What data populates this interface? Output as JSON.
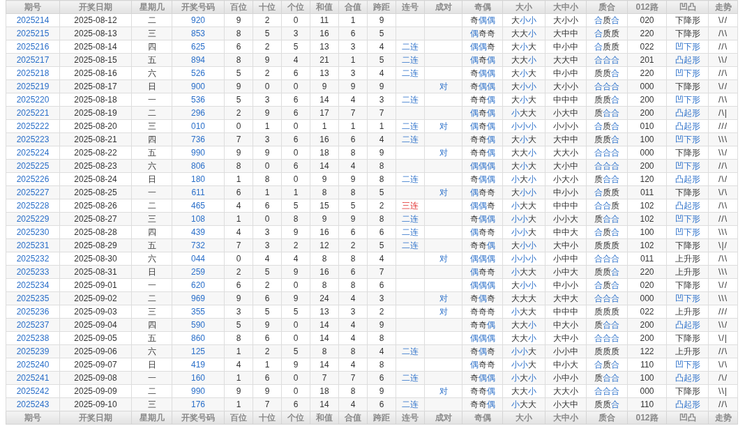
{
  "columns": [
    "期号",
    "开奖日期",
    "星期几",
    "开奖号码",
    "百位",
    "十位",
    "个位",
    "和值",
    "合值",
    "跨距",
    "连号",
    "成对",
    "奇偶",
    "大小",
    "大中小",
    "质合",
    "012路",
    "凹凸",
    "走势"
  ],
  "rows": [
    {
      "issue": "2025214",
      "date": "2025-08-12",
      "weekday": "二",
      "number": "920",
      "digits": [
        "9",
        "2",
        "0"
      ],
      "sum": "11",
      "sum_tail": "1",
      "span": "9",
      "parity": "奇偶偶",
      "parity_hl": [
        false,
        true,
        true
      ],
      "size": "大小小",
      "size_hl": [
        false,
        true,
        true
      ],
      "range": "大小小",
      "prime": "合质合",
      "prime_hl": [
        true,
        false,
        true
      ],
      "route": "020",
      "shape": "下降形",
      "shape_hl": false,
      "trend": "\\//"
    },
    {
      "issue": "2025215",
      "date": "2025-08-13",
      "weekday": "三",
      "number": "853",
      "digits": [
        "8",
        "5",
        "3"
      ],
      "sum": "16",
      "sum_tail": "6",
      "span": "5",
      "parity": "偶奇奇",
      "parity_hl": [
        true,
        false,
        false
      ],
      "size": "大大小",
      "size_hl": [
        false,
        false,
        true
      ],
      "range": "大中中",
      "prime": "合质质",
      "prime_hl": [
        true,
        false,
        false
      ],
      "route": "220",
      "shape": "下降形",
      "shape_hl": false,
      "trend": "/\\\\"
    },
    {
      "issue": "2025216",
      "date": "2025-08-14",
      "weekday": "四",
      "number": "625",
      "digits": [
        "6",
        "2",
        "5"
      ],
      "sum": "13",
      "sum_tail": "3",
      "span": "4",
      "consecutive": "二连",
      "consecutive_alert": false,
      "parity": "偶偶奇",
      "parity_hl": [
        true,
        true,
        false
      ],
      "size": "大小大",
      "size_hl": [
        false,
        true,
        false
      ],
      "range": "中小中",
      "prime": "合质质",
      "prime_hl": [
        true,
        false,
        false
      ],
      "route": "022",
      "shape": "凹下形",
      "shape_hl": true,
      "trend": "//\\"
    },
    {
      "issue": "2025217",
      "date": "2025-08-15",
      "weekday": "五",
      "number": "894",
      "digits": [
        "8",
        "9",
        "4"
      ],
      "sum": "21",
      "sum_tail": "1",
      "span": "5",
      "consecutive": "二连",
      "consecutive_alert": false,
      "parity": "偶奇偶",
      "parity_hl": [
        true,
        false,
        true
      ],
      "size": "大大小",
      "size_hl": [
        false,
        false,
        true
      ],
      "range": "大大中",
      "prime": "合合合",
      "prime_hl": [
        true,
        true,
        true
      ],
      "route": "201",
      "shape": "凸起形",
      "shape_hl": true,
      "trend": "\\\\/"
    },
    {
      "issue": "2025218",
      "date": "2025-08-16",
      "weekday": "六",
      "number": "526",
      "digits": [
        "5",
        "2",
        "6"
      ],
      "sum": "13",
      "sum_tail": "3",
      "span": "4",
      "consecutive": "二连",
      "consecutive_alert": false,
      "parity": "奇偶偶",
      "parity_hl": [
        false,
        true,
        true
      ],
      "size": "大小大",
      "size_hl": [
        false,
        true,
        false
      ],
      "range": "中小中",
      "prime": "质质合",
      "prime_hl": [
        false,
        false,
        true
      ],
      "route": "220",
      "shape": "凹下形",
      "shape_hl": true,
      "trend": "//\\"
    },
    {
      "issue": "2025219",
      "date": "2025-08-17",
      "weekday": "日",
      "number": "900",
      "digits": [
        "9",
        "0",
        "0"
      ],
      "sum": "9",
      "sum_tail": "9",
      "span": "9",
      "pair": "对",
      "parity": "奇偶偶",
      "parity_hl": [
        false,
        true,
        true
      ],
      "size": "大小小",
      "size_hl": [
        false,
        true,
        true
      ],
      "range": "大小小",
      "prime": "合合合",
      "prime_hl": [
        true,
        true,
        true
      ],
      "route": "000",
      "shape": "下降形",
      "shape_hl": false,
      "trend": "\\//"
    },
    {
      "issue": "2025220",
      "date": "2025-08-18",
      "weekday": "一",
      "number": "536",
      "digits": [
        "5",
        "3",
        "6"
      ],
      "sum": "14",
      "sum_tail": "4",
      "span": "3",
      "consecutive": "二连",
      "consecutive_alert": false,
      "parity": "奇奇偶",
      "parity_hl": [
        false,
        false,
        true
      ],
      "size": "大小大",
      "size_hl": [
        false,
        true,
        false
      ],
      "range": "中中中",
      "prime": "质质合",
      "prime_hl": [
        false,
        false,
        true
      ],
      "route": "200",
      "shape": "凹下形",
      "shape_hl": true,
      "trend": "/\\\\"
    },
    {
      "issue": "2025221",
      "date": "2025-08-19",
      "weekday": "二",
      "number": "296",
      "digits": [
        "2",
        "9",
        "6"
      ],
      "sum": "17",
      "sum_tail": "7",
      "span": "7",
      "parity": "偶奇偶",
      "parity_hl": [
        true,
        false,
        true
      ],
      "size": "小大大",
      "size_hl": [
        true,
        false,
        false
      ],
      "range": "小大中",
      "prime": "质合合",
      "prime_hl": [
        false,
        true,
        true
      ],
      "route": "200",
      "shape": "凸起形",
      "shape_hl": true,
      "trend": "/\\|"
    },
    {
      "issue": "2025222",
      "date": "2025-08-20",
      "weekday": "三",
      "number": "010",
      "digits": [
        "0",
        "1",
        "0"
      ],
      "sum": "1",
      "sum_tail": "1",
      "span": "1",
      "consecutive": "二连",
      "consecutive_alert": false,
      "pair": "对",
      "parity": "偶奇偶",
      "parity_hl": [
        true,
        false,
        true
      ],
      "size": "小小小",
      "size_hl": [
        true,
        true,
        true
      ],
      "range": "小小小",
      "prime": "合质合",
      "prime_hl": [
        true,
        false,
        true
      ],
      "route": "010",
      "shape": "凸起形",
      "shape_hl": true,
      "trend": "///"
    },
    {
      "issue": "2025223",
      "date": "2025-08-21",
      "weekday": "四",
      "number": "736",
      "digits": [
        "7",
        "3",
        "6"
      ],
      "sum": "16",
      "sum_tail": "6",
      "span": "4",
      "consecutive": "二连",
      "consecutive_alert": false,
      "parity": "奇奇偶",
      "parity_hl": [
        false,
        false,
        true
      ],
      "size": "大小大",
      "size_hl": [
        false,
        true,
        false
      ],
      "range": "大中中",
      "prime": "质质合",
      "prime_hl": [
        false,
        false,
        true
      ],
      "route": "100",
      "shape": "凹下形",
      "shape_hl": true,
      "trend": "\\\\\\"
    },
    {
      "issue": "2025224",
      "date": "2025-08-22",
      "weekday": "五",
      "number": "990",
      "digits": [
        "9",
        "9",
        "0"
      ],
      "sum": "18",
      "sum_tail": "8",
      "span": "9",
      "pair": "对",
      "parity": "奇奇偶",
      "parity_hl": [
        false,
        false,
        true
      ],
      "size": "大大小",
      "size_hl": [
        false,
        false,
        true
      ],
      "range": "大大小",
      "prime": "合合合",
      "prime_hl": [
        true,
        true,
        true
      ],
      "route": "000",
      "shape": "下降形",
      "shape_hl": false,
      "trend": "\\\\/"
    },
    {
      "issue": "2025225",
      "date": "2025-08-23",
      "weekday": "六",
      "number": "806",
      "digits": [
        "8",
        "0",
        "6"
      ],
      "sum": "14",
      "sum_tail": "4",
      "span": "8",
      "parity": "偶偶偶",
      "parity_hl": [
        true,
        true,
        true
      ],
      "size": "大小大",
      "size_hl": [
        false,
        true,
        false
      ],
      "range": "大小中",
      "prime": "合合合",
      "prime_hl": [
        true,
        true,
        true
      ],
      "route": "200",
      "shape": "凹下形",
      "shape_hl": true,
      "trend": "//\\"
    },
    {
      "issue": "2025226",
      "date": "2025-08-24",
      "weekday": "日",
      "number": "180",
      "digits": [
        "1",
        "8",
        "0"
      ],
      "sum": "9",
      "sum_tail": "9",
      "span": "8",
      "consecutive": "二连",
      "consecutive_alert": false,
      "parity": "奇偶偶",
      "parity_hl": [
        false,
        true,
        true
      ],
      "size": "小大小",
      "size_hl": [
        true,
        false,
        true
      ],
      "range": "小大小",
      "prime": "质合合",
      "prime_hl": [
        false,
        true,
        true
      ],
      "route": "120",
      "shape": "凸起形",
      "shape_hl": true,
      "trend": "/\\/"
    },
    {
      "issue": "2025227",
      "date": "2025-08-25",
      "weekday": "一",
      "number": "611",
      "digits": [
        "6",
        "1",
        "1"
      ],
      "sum": "8",
      "sum_tail": "8",
      "span": "5",
      "pair": "对",
      "parity": "偶奇奇",
      "parity_hl": [
        true,
        false,
        false
      ],
      "size": "大小小",
      "size_hl": [
        false,
        true,
        true
      ],
      "range": "中小小",
      "prime": "合质质",
      "prime_hl": [
        true,
        false,
        false
      ],
      "route": "011",
      "shape": "下降形",
      "shape_hl": false,
      "trend": "\\/\\"
    },
    {
      "issue": "2025228",
      "date": "2025-08-26",
      "weekday": "二",
      "number": "465",
      "digits": [
        "4",
        "6",
        "5"
      ],
      "sum": "15",
      "sum_tail": "5",
      "span": "2",
      "consecutive": "三连",
      "consecutive_alert": true,
      "parity": "偶偶奇",
      "parity_hl": [
        true,
        true,
        false
      ],
      "size": "小大大",
      "size_hl": [
        true,
        false,
        false
      ],
      "range": "中中中",
      "prime": "合合质",
      "prime_hl": [
        true,
        true,
        false
      ],
      "route": "102",
      "shape": "凸起形",
      "shape_hl": true,
      "trend": "/\\\\"
    },
    {
      "issue": "2025229",
      "date": "2025-08-27",
      "weekday": "三",
      "number": "108",
      "digits": [
        "1",
        "0",
        "8"
      ],
      "sum": "9",
      "sum_tail": "9",
      "span": "8",
      "consecutive": "二连",
      "consecutive_alert": false,
      "parity": "奇偶偶",
      "parity_hl": [
        false,
        true,
        true
      ],
      "size": "小小大",
      "size_hl": [
        true,
        true,
        false
      ],
      "range": "小小大",
      "prime": "质合合",
      "prime_hl": [
        false,
        true,
        true
      ],
      "route": "102",
      "shape": "凹下形",
      "shape_hl": true,
      "trend": "//\\"
    },
    {
      "issue": "2025230",
      "date": "2025-08-28",
      "weekday": "四",
      "number": "439",
      "digits": [
        "4",
        "3",
        "9"
      ],
      "sum": "16",
      "sum_tail": "6",
      "span": "6",
      "consecutive": "二连",
      "consecutive_alert": false,
      "parity": "偶奇奇",
      "parity_hl": [
        true,
        false,
        false
      ],
      "size": "小小大",
      "size_hl": [
        true,
        true,
        false
      ],
      "range": "中中大",
      "prime": "合质合",
      "prime_hl": [
        true,
        false,
        true
      ],
      "route": "100",
      "shape": "凹下形",
      "shape_hl": true,
      "trend": "\\\\\\"
    },
    {
      "issue": "2025231",
      "date": "2025-08-29",
      "weekday": "五",
      "number": "732",
      "digits": [
        "7",
        "3",
        "2"
      ],
      "sum": "12",
      "sum_tail": "2",
      "span": "5",
      "consecutive": "二连",
      "consecutive_alert": false,
      "parity": "奇奇偶",
      "parity_hl": [
        false,
        false,
        true
      ],
      "size": "大小小",
      "size_hl": [
        false,
        true,
        true
      ],
      "range": "大中小",
      "prime": "质质质",
      "prime_hl": [
        false,
        false,
        false
      ],
      "route": "102",
      "shape": "下降形",
      "shape_hl": false,
      "trend": "\\|/"
    },
    {
      "issue": "2025232",
      "date": "2025-08-30",
      "weekday": "六",
      "number": "044",
      "digits": [
        "0",
        "4",
        "4"
      ],
      "sum": "8",
      "sum_tail": "8",
      "span": "4",
      "pair": "对",
      "parity": "偶偶偶",
      "parity_hl": [
        true,
        true,
        true
      ],
      "size": "小小小",
      "size_hl": [
        true,
        true,
        true
      ],
      "range": "小中中",
      "prime": "合合合",
      "prime_hl": [
        true,
        true,
        true
      ],
      "route": "011",
      "shape": "上升形",
      "shape_hl": false,
      "trend": "/\\\\"
    },
    {
      "issue": "2025233",
      "date": "2025-08-31",
      "weekday": "日",
      "number": "259",
      "digits": [
        "2",
        "5",
        "9"
      ],
      "sum": "16",
      "sum_tail": "6",
      "span": "7",
      "parity": "偶奇奇",
      "parity_hl": [
        true,
        false,
        false
      ],
      "size": "小大大",
      "size_hl": [
        true,
        false,
        false
      ],
      "range": "小中大",
      "prime": "质质合",
      "prime_hl": [
        false,
        false,
        true
      ],
      "route": "220",
      "shape": "上升形",
      "shape_hl": false,
      "trend": "\\\\\\"
    },
    {
      "issue": "2025234",
      "date": "2025-09-01",
      "weekday": "一",
      "number": "620",
      "digits": [
        "6",
        "2",
        "0"
      ],
      "sum": "8",
      "sum_tail": "8",
      "span": "6",
      "parity": "偶偶偶",
      "parity_hl": [
        true,
        true,
        true
      ],
      "size": "大小小",
      "size_hl": [
        false,
        true,
        true
      ],
      "range": "中小小",
      "prime": "合质合",
      "prime_hl": [
        true,
        false,
        true
      ],
      "route": "020",
      "shape": "下降形",
      "shape_hl": false,
      "trend": "\\//"
    },
    {
      "issue": "2025235",
      "date": "2025-09-02",
      "weekday": "二",
      "number": "969",
      "digits": [
        "9",
        "6",
        "9"
      ],
      "sum": "24",
      "sum_tail": "4",
      "span": "3",
      "pair": "对",
      "parity": "奇偶奇",
      "parity_hl": [
        false,
        true,
        false
      ],
      "size": "大大大",
      "size_hl": [
        false,
        false,
        false
      ],
      "range": "大中大",
      "prime": "合合合",
      "prime_hl": [
        true,
        true,
        true
      ],
      "route": "000",
      "shape": "凹下形",
      "shape_hl": true,
      "trend": "\\\\\\"
    },
    {
      "issue": "2025236",
      "date": "2025-09-03",
      "weekday": "三",
      "number": "355",
      "digits": [
        "3",
        "5",
        "5"
      ],
      "sum": "13",
      "sum_tail": "3",
      "span": "2",
      "pair": "对",
      "parity": "奇奇奇",
      "parity_hl": [
        false,
        false,
        false
      ],
      "size": "小大大",
      "size_hl": [
        true,
        false,
        false
      ],
      "range": "中中中",
      "prime": "质质质",
      "prime_hl": [
        false,
        false,
        false
      ],
      "route": "022",
      "shape": "上升形",
      "shape_hl": false,
      "trend": "///"
    },
    {
      "issue": "2025237",
      "date": "2025-09-04",
      "weekday": "四",
      "number": "590",
      "digits": [
        "5",
        "9",
        "0"
      ],
      "sum": "14",
      "sum_tail": "4",
      "span": "9",
      "parity": "奇奇偶",
      "parity_hl": [
        false,
        false,
        true
      ],
      "size": "大大小",
      "size_hl": [
        false,
        false,
        true
      ],
      "range": "中大小",
      "prime": "质合合",
      "prime_hl": [
        false,
        true,
        true
      ],
      "route": "200",
      "shape": "凸起形",
      "shape_hl": true,
      "trend": "\\\\/"
    },
    {
      "issue": "2025238",
      "date": "2025-09-05",
      "weekday": "五",
      "number": "860",
      "digits": [
        "8",
        "6",
        "0"
      ],
      "sum": "14",
      "sum_tail": "4",
      "span": "8",
      "parity": "偶偶偶",
      "parity_hl": [
        true,
        true,
        true
      ],
      "size": "大大小",
      "size_hl": [
        false,
        false,
        true
      ],
      "range": "大中小",
      "prime": "合合合",
      "prime_hl": [
        true,
        true,
        true
      ],
      "route": "200",
      "shape": "下降形",
      "shape_hl": false,
      "trend": "\\/|"
    },
    {
      "issue": "2025239",
      "date": "2025-09-06",
      "weekday": "六",
      "number": "125",
      "digits": [
        "1",
        "2",
        "5"
      ],
      "sum": "8",
      "sum_tail": "8",
      "span": "4",
      "consecutive": "二连",
      "consecutive_alert": false,
      "parity": "奇偶奇",
      "parity_hl": [
        false,
        true,
        false
      ],
      "size": "小小大",
      "size_hl": [
        true,
        true,
        false
      ],
      "range": "小小中",
      "prime": "质质质",
      "prime_hl": [
        false,
        false,
        false
      ],
      "route": "122",
      "shape": "上升形",
      "shape_hl": false,
      "trend": "//\\"
    },
    {
      "issue": "2025240",
      "date": "2025-09-07",
      "weekday": "日",
      "number": "419",
      "digits": [
        "4",
        "1",
        "9"
      ],
      "sum": "14",
      "sum_tail": "4",
      "span": "8",
      "parity": "偶奇奇",
      "parity_hl": [
        true,
        false,
        false
      ],
      "size": "小小大",
      "size_hl": [
        true,
        true,
        false
      ],
      "range": "中小大",
      "prime": "合质合",
      "prime_hl": [
        true,
        false,
        true
      ],
      "route": "110",
      "shape": "凹下形",
      "shape_hl": true,
      "trend": "\\/\\"
    },
    {
      "issue": "2025241",
      "date": "2025-09-08",
      "weekday": "一",
      "number": "160",
      "digits": [
        "1",
        "6",
        "0"
      ],
      "sum": "7",
      "sum_tail": "7",
      "span": "6",
      "consecutive": "二连",
      "consecutive_alert": false,
      "parity": "奇偶偶",
      "parity_hl": [
        false,
        true,
        true
      ],
      "size": "小大小",
      "size_hl": [
        true,
        false,
        true
      ],
      "range": "小中小",
      "prime": "质合合",
      "prime_hl": [
        false,
        true,
        true
      ],
      "route": "100",
      "shape": "凸起形",
      "shape_hl": true,
      "trend": "/\\/"
    },
    {
      "issue": "2025242",
      "date": "2025-09-09",
      "weekday": "二",
      "number": "990",
      "digits": [
        "9",
        "9",
        "0"
      ],
      "sum": "18",
      "sum_tail": "8",
      "span": "9",
      "pair": "对",
      "parity": "奇奇偶",
      "parity_hl": [
        false,
        false,
        true
      ],
      "size": "大大小",
      "size_hl": [
        false,
        false,
        true
      ],
      "range": "大大小",
      "prime": "合合合",
      "prime_hl": [
        true,
        true,
        true
      ],
      "route": "000",
      "shape": "下降形",
      "shape_hl": false,
      "trend": "\\\\|"
    },
    {
      "issue": "2025243",
      "date": "2025-09-10",
      "weekday": "三",
      "number": "176",
      "digits": [
        "1",
        "7",
        "6"
      ],
      "sum": "14",
      "sum_tail": "4",
      "span": "6",
      "consecutive": "二连",
      "consecutive_alert": false,
      "parity": "奇奇偶",
      "parity_hl": [
        false,
        false,
        true
      ],
      "size": "小大大",
      "size_hl": [
        true,
        false,
        false
      ],
      "range": "小大中",
      "prime": "质质合",
      "prime_hl": [
        false,
        false,
        true
      ],
      "route": "110",
      "shape": "凸起形",
      "shape_hl": true,
      "trend": "//\\"
    }
  ],
  "footer_columns": [
    "期号",
    "开奖日期",
    "星期几",
    "开奖号码",
    "百位",
    "十位",
    "个位",
    "和值",
    "合值",
    "跨距",
    "连号",
    "成对",
    "奇偶",
    "大小",
    "大中小",
    "质合",
    "012路",
    "凹凸",
    "走势"
  ]
}
